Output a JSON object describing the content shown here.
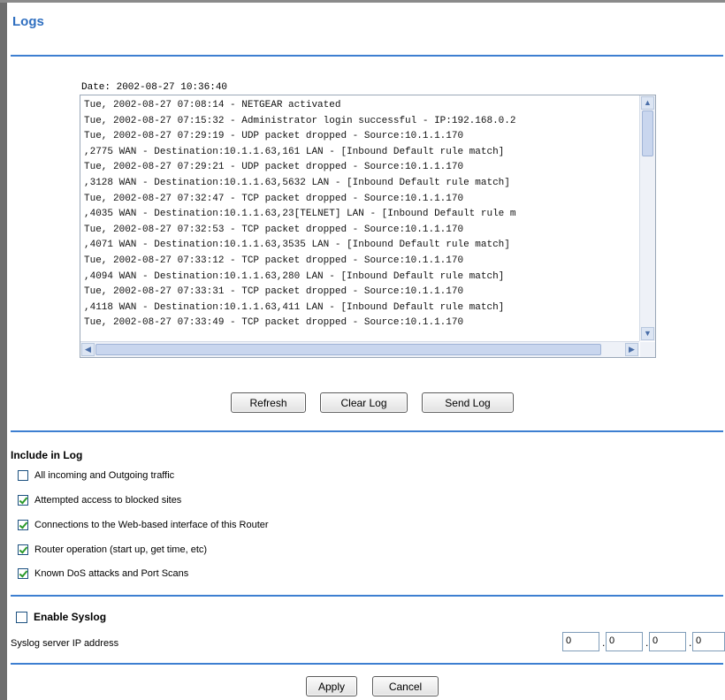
{
  "page": {
    "title": "Logs"
  },
  "log": {
    "date_line": "Date: 2002-08-27 10:36:40",
    "lines": [
      "Tue, 2002-08-27 07:08:14 - NETGEAR activated",
      "Tue, 2002-08-27 07:15:32 - Administrator login successful - IP:192.168.0.2",
      "Tue, 2002-08-27 07:29:19 - UDP packet dropped - Source:10.1.1.170",
      ",2775 WAN - Destination:10.1.1.63,161 LAN - [Inbound Default rule match]",
      "Tue, 2002-08-27 07:29:21 - UDP packet dropped - Source:10.1.1.170",
      ",3128 WAN - Destination:10.1.1.63,5632 LAN - [Inbound Default rule match]",
      "Tue, 2002-08-27 07:32:47 - TCP packet dropped - Source:10.1.1.170",
      ",4035 WAN - Destination:10.1.1.63,23[TELNET] LAN - [Inbound Default rule m",
      "Tue, 2002-08-27 07:32:53 - TCP packet dropped - Source:10.1.1.170",
      ",4071 WAN - Destination:10.1.1.63,3535 LAN - [Inbound Default rule match]",
      "Tue, 2002-08-27 07:33:12 - TCP packet dropped - Source:10.1.1.170",
      ",4094 WAN - Destination:10.1.1.63,280 LAN - [Inbound Default rule match]",
      "Tue, 2002-08-27 07:33:31 - TCP packet dropped - Source:10.1.1.170",
      ",4118 WAN - Destination:10.1.1.63,411 LAN - [Inbound Default rule match]",
      "Tue, 2002-08-27 07:33:49 - TCP packet dropped - Source:10.1.1.170"
    ]
  },
  "buttons": {
    "refresh": "Refresh",
    "clear_log": "Clear Log",
    "send_log": "Send Log",
    "apply": "Apply",
    "cancel": "Cancel"
  },
  "include": {
    "title": "Include in Log",
    "options": [
      {
        "label": "All incoming and Outgoing traffic",
        "checked": false
      },
      {
        "label": "Attempted access to blocked sites",
        "checked": true
      },
      {
        "label": "Connections to the Web-based interface of this Router",
        "checked": true
      },
      {
        "label": "Router operation (start up, get time, etc)",
        "checked": true
      },
      {
        "label": "Known DoS attacks and Port Scans",
        "checked": true
      }
    ]
  },
  "syslog": {
    "enable_label": "Enable Syslog",
    "enabled": false,
    "ip_label": "Syslog server IP address",
    "ip": [
      "0",
      "0",
      "0",
      "0"
    ]
  },
  "colors": {
    "title": "#2f6fc0",
    "rule": "#3d7fd1",
    "check": "#2b9a2b"
  }
}
